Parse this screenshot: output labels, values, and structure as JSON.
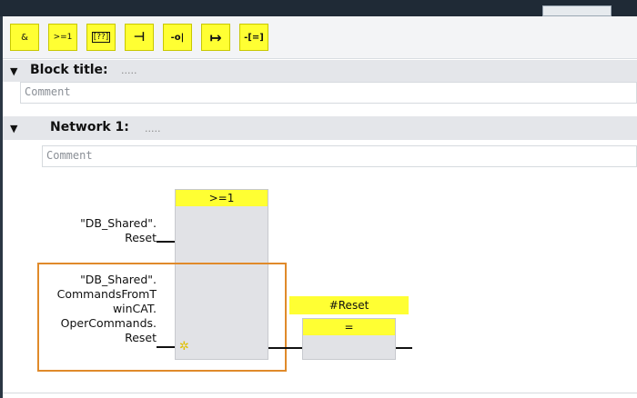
{
  "toolbar": {
    "buttons": [
      {
        "label": "&",
        "icon": "and-gate-icon"
      },
      {
        "label": ">=1",
        "icon": "or-gate-icon"
      },
      {
        "label": "[??]",
        "icon": "empty-box-icon"
      },
      {
        "label": "⊣",
        "icon": "open-branch-icon"
      },
      {
        "label": "-o|",
        "icon": "negate-input-icon"
      },
      {
        "label": "↦",
        "icon": "assignment-arrow-icon"
      },
      {
        "label": "-[=]",
        "icon": "assignment-box-icon"
      }
    ]
  },
  "block": {
    "title": "Block title:",
    "title_suffix": ".....",
    "comment_placeholder": "Comment"
  },
  "network": {
    "title": "Network 1:",
    "title_suffix": ".....",
    "comment_placeholder": "Comment"
  },
  "diagram": {
    "or_box_label": ">=1",
    "input1": [
      "\"DB_Shared\".",
      "Reset"
    ],
    "input2": [
      "\"DB_Shared\".",
      "CommandsFromT",
      "winCAT.",
      "OperCommands.",
      "Reset"
    ],
    "assign_operand": "#Reset",
    "assign_box_label": "=",
    "new_input_marker": "✲"
  },
  "colors": {
    "accent_yellow": "#ffff33",
    "selection_orange": "#e08a2a",
    "header_gray": "#e4e6ea"
  }
}
